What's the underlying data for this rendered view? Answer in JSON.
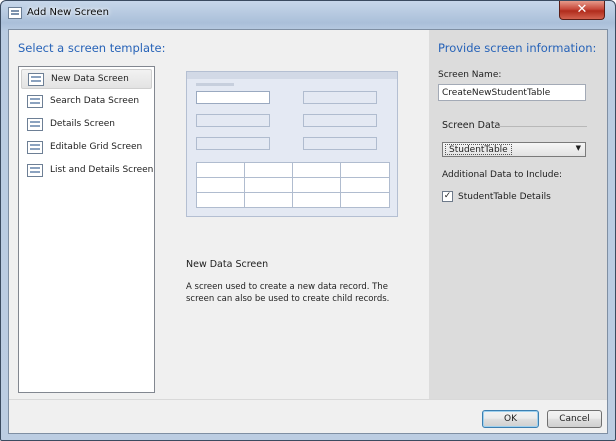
{
  "window": {
    "title": "Add New Screen",
    "close_glyph": "✕"
  },
  "left": {
    "heading": "Select a screen template:",
    "templates": [
      {
        "label": "New Data Screen",
        "selected": true,
        "icon": "new-data-screen-icon"
      },
      {
        "label": "Search Data Screen",
        "selected": false,
        "icon": "search-data-screen-icon"
      },
      {
        "label": "Details Screen",
        "selected": false,
        "icon": "details-screen-icon"
      },
      {
        "label": "Editable Grid Screen",
        "selected": false,
        "icon": "editable-grid-screen-icon"
      },
      {
        "label": "List and Details Screen",
        "selected": false,
        "icon": "list-and-details-screen-icon"
      }
    ],
    "description_title": "New Data Screen",
    "description_text": "A screen used to create a new data record.  The screen can also be used to create child records."
  },
  "right": {
    "heading": "Provide screen information:",
    "screen_name_label": "Screen Name:",
    "screen_name_value": "CreateNewStudentTable",
    "screen_data_label": "Screen Data",
    "screen_data_value": "StudentTable",
    "screen_data_arrow": "▼",
    "additional_label": "Additional Data to Include:",
    "checkbox_label": "StudentTable Details",
    "checkbox_checked": true,
    "checkbox_glyph": "✓"
  },
  "footer": {
    "ok_label": "OK",
    "cancel_label": "Cancel"
  },
  "colors": {
    "heading": "#2763b8",
    "right_panel": "#dcdcdc",
    "client": "#f0f0f0"
  }
}
